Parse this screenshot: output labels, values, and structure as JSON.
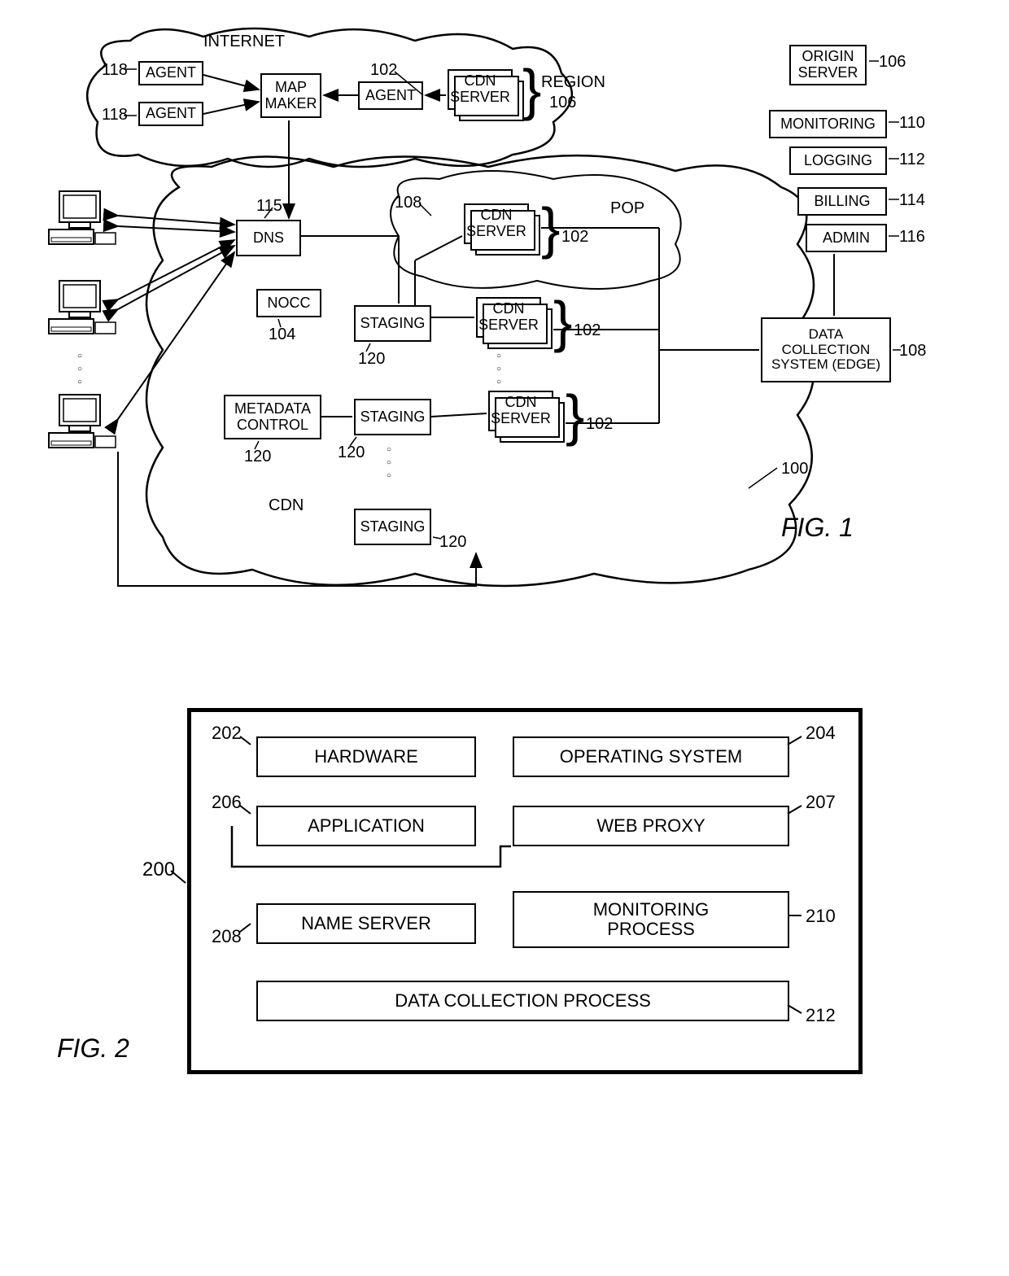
{
  "fig1": {
    "internetLabel": "INTERNET",
    "agent1": "AGENT",
    "agent2": "AGENT",
    "agentRef1": "118",
    "agentRef2": "118",
    "mapMaker": "MAP\nMAKER",
    "agent3": "AGENT",
    "agentRef3": "102",
    "cdnServer": "CDN\nSERVER",
    "region": "REGION",
    "regionRef": "106",
    "originServer": "ORIGIN\nSERVER",
    "originRef": "106",
    "monitoring": "MONITORING",
    "monitoringRef": "110",
    "logging": "LOGGING",
    "loggingRef": "112",
    "billing": "BILLING",
    "billingRef": "114",
    "admin": "ADMIN",
    "adminRef": "116",
    "dns": "DNS",
    "dnsRef": "115",
    "popLabel": "POP",
    "popRef": "108",
    "popServerRef": "102",
    "nocc": "NOCC",
    "noccRef": "104",
    "staging": "STAGING",
    "stagingRef": "120",
    "cdnServerRef": "102",
    "metadataControl": "METADATA\nCONTROL",
    "metadataRef": "120",
    "staging2Ref": "120",
    "staging3Ref": "120",
    "dataCollection": "DATA\nCOLLECTION\nSYSTEM (EDGE)",
    "dataCollectionRef": "108",
    "cdnLabel": "CDN",
    "systemRef": "100",
    "caption": "FIG. 1"
  },
  "fig2": {
    "ref": "200",
    "hardware": "HARDWARE",
    "hardwareRef": "202",
    "os": "OPERATING SYSTEM",
    "osRef": "204",
    "application": "APPLICATION",
    "applicationRef": "206",
    "webProxy": "WEB PROXY",
    "webProxyRef": "207",
    "nameServer": "NAME SERVER",
    "nameServerRef": "208",
    "monitoring": "MONITORING\nPROCESS",
    "monitoringRef": "210",
    "dataCollection": "DATA COLLECTION PROCESS",
    "dataCollectionRef": "212",
    "caption": "FIG. 2"
  }
}
